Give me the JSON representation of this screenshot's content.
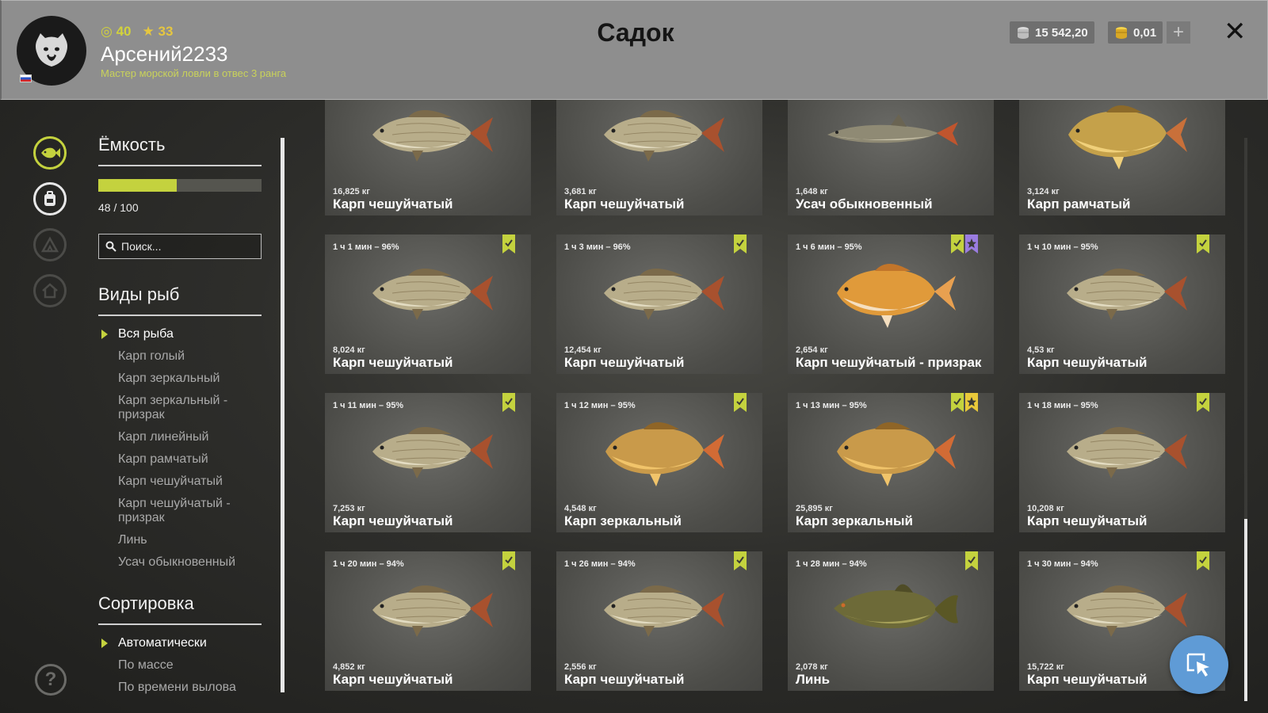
{
  "header": {
    "title": "Садок",
    "level": "40",
    "rank": "33",
    "username": "Арсений2233",
    "subtitle": "Мастер морской ловли в отвес 3 ранга",
    "silver": "15 542,20",
    "gold": "0,01",
    "plus_label": "+",
    "close_label": "✕"
  },
  "capacity": {
    "title": "Ёмкость",
    "value": 48,
    "max": 100,
    "label": "48 / 100"
  },
  "search": {
    "placeholder": "Поиск..."
  },
  "species": {
    "title": "Виды рыб",
    "items": [
      "Вся рыба",
      "Карп голый",
      "Карп зеркальный",
      "Карп зеркальный - призрак",
      "Карп линейный",
      "Карп рамчатый",
      "Карп чешуйчатый",
      "Карп чешуйчатый - призрак",
      "Линь",
      "Усач обыкновенный"
    ],
    "selected": 0
  },
  "sorting": {
    "title": "Сортировка",
    "items": [
      "Автоматически",
      "По массе",
      "По времени вылова"
    ],
    "selected": 0
  },
  "help_label": "?",
  "colors": {
    "accent": "#c4d23e",
    "bookmark_green": "#c4d23e",
    "bookmark_purple": "#9a7ce0",
    "bookmark_yellow": "#e8c83a",
    "fab": "#5f9bd6"
  },
  "cards": [
    {
      "time": "",
      "weight": "16,825 кг",
      "name": "Карп чешуйчатый",
      "fish": "scaled",
      "marks": []
    },
    {
      "time": "",
      "weight": "3,681 кг",
      "name": "Карп чешуйчатый",
      "fish": "scaled",
      "marks": []
    },
    {
      "time": "",
      "weight": "1,648 кг",
      "name": "Усач обыкновенный",
      "fish": "barbel",
      "marks": []
    },
    {
      "time": "",
      "weight": "3,124 кг",
      "name": "Карп рамчатый",
      "fish": "frame",
      "marks": []
    },
    {
      "time": "1 ч 1 мин – 96%",
      "weight": "8,024 кг",
      "name": "Карп чешуйчатый",
      "fish": "scaled",
      "marks": [
        "green"
      ]
    },
    {
      "time": "1 ч 3 мин – 96%",
      "weight": "12,454 кг",
      "name": "Карп чешуйчатый",
      "fish": "scaled",
      "marks": [
        "green"
      ]
    },
    {
      "time": "1 ч 6 мин – 95%",
      "weight": "2,654 кг",
      "name": "Карп чешуйчатый - призрак",
      "fish": "ghost",
      "marks": [
        "green",
        "purple"
      ]
    },
    {
      "time": "1 ч 10 мин – 95%",
      "weight": "4,53 кг",
      "name": "Карп чешуйчатый",
      "fish": "scaled",
      "marks": [
        "green"
      ]
    },
    {
      "time": "1 ч 11 мин – 95%",
      "weight": "7,253 кг",
      "name": "Карп чешуйчатый",
      "fish": "scaled",
      "marks": [
        "green"
      ]
    },
    {
      "time": "1 ч 12 мин – 95%",
      "weight": "4,548 кг",
      "name": "Карп зеркальный",
      "fish": "mirror",
      "marks": [
        "green"
      ]
    },
    {
      "time": "1 ч 13 мин – 95%",
      "weight": "25,895 кг",
      "name": "Карп зеркальный",
      "fish": "mirror",
      "marks": [
        "green",
        "yellow"
      ]
    },
    {
      "time": "1 ч 18 мин – 95%",
      "weight": "10,208 кг",
      "name": "Карп чешуйчатый",
      "fish": "scaled",
      "marks": [
        "green"
      ]
    },
    {
      "time": "1 ч 20 мин – 94%",
      "weight": "4,852 кг",
      "name": "Карп чешуйчатый",
      "fish": "scaled",
      "marks": [
        "green"
      ]
    },
    {
      "time": "1 ч 26 мин – 94%",
      "weight": "2,556 кг",
      "name": "Карп чешуйчатый",
      "fish": "scaled",
      "marks": [
        "green"
      ]
    },
    {
      "time": "1 ч 28 мин – 94%",
      "weight": "2,078 кг",
      "name": "Линь",
      "fish": "tench",
      "marks": [
        "green"
      ]
    },
    {
      "time": "1 ч 30 мин – 94%",
      "weight": "15,722 кг",
      "name": "Карп чешуйчатый",
      "fish": "scaled",
      "marks": [
        "green"
      ]
    }
  ]
}
